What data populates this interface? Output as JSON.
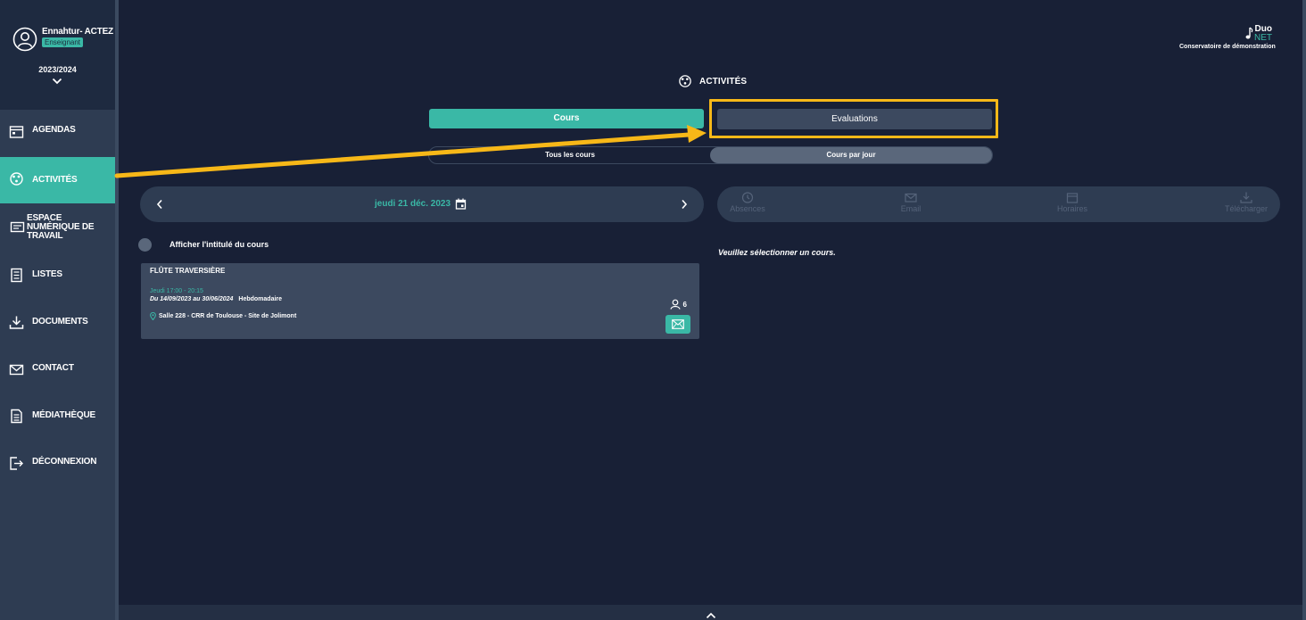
{
  "user": {
    "name": "Ennahtur- ACTEZ",
    "role": "Enseignant",
    "year": "2023/2024"
  },
  "nav": {
    "items": [
      {
        "label": "AGENDAS",
        "icon": "calendar-icon"
      },
      {
        "label": "ACTIVITÉS",
        "icon": "activities-icon",
        "active": true
      },
      {
        "label": "ESPACE NUMÉRIQUE DE TRAVAIL",
        "icon": "workspace-icon"
      },
      {
        "label": "LISTES",
        "icon": "lists-icon"
      },
      {
        "label": "DOCUMENTS",
        "icon": "download-icon"
      },
      {
        "label": "CONTACT",
        "icon": "mail-icon"
      },
      {
        "label": "MÉDIATHÈQUE",
        "icon": "media-icon"
      },
      {
        "label": "DÉCONNEXION",
        "icon": "logout-icon"
      }
    ]
  },
  "brand": {
    "duo": "Duo",
    "net": "NET",
    "subtitle": "Conservatoire de démonstration"
  },
  "page": {
    "title": "ACTIVITÉS"
  },
  "tabs": {
    "cours": "Cours",
    "evaluations": "Evaluations"
  },
  "toggle": {
    "all": "Tous les cours",
    "per_day": "Cours par jour"
  },
  "date_nav": {
    "date": "jeudi 21 déc. 2023"
  },
  "actions": {
    "absences": "Absences",
    "email": "Email",
    "horaires": "Horaires",
    "telecharger": "Télécharger"
  },
  "options": {
    "show_title": "Afficher l'intitulé du cours"
  },
  "course": {
    "title": "FLÛTE TRAVERSIÈRE",
    "time": "Jeudi 17:00 - 20:15",
    "period": "Du 14/09/2023 au 30/06/2024",
    "frequency": "Hebdomadaire",
    "room": "Salle 228 - CRR de Toulouse - Site de Jolimont",
    "students": "6"
  },
  "messages": {
    "select_course": "Veuillez sélectionner un cours."
  },
  "colors": {
    "accent": "#3ab8a6",
    "highlight": "#f7b818",
    "background": "#182036",
    "sidebar": "#2e3c52"
  }
}
